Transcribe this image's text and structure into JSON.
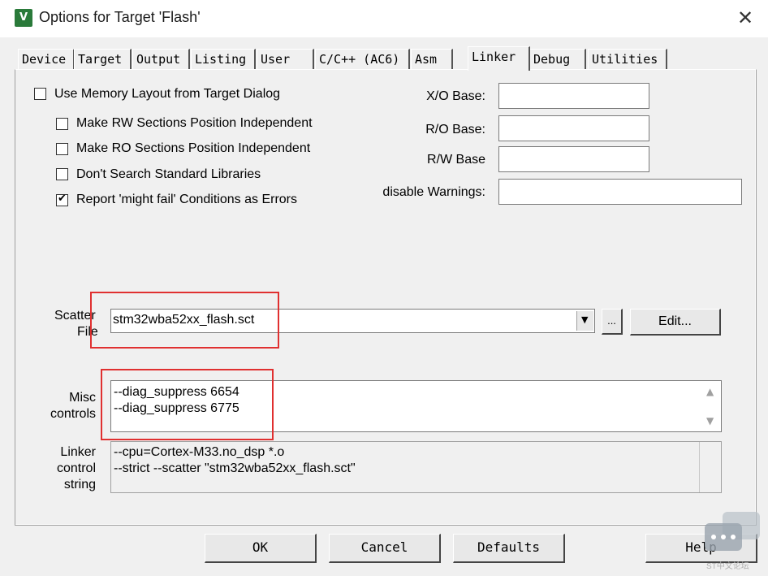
{
  "window": {
    "title": "Options for Target 'Flash'",
    "icon": "keil-uvision-icon",
    "close_glyph": "✕"
  },
  "tabs": [
    {
      "label": "Device"
    },
    {
      "label": "Target"
    },
    {
      "label": "Output"
    },
    {
      "label": "Listing"
    },
    {
      "label": "User"
    },
    {
      "label": "C/C++ (AC6)"
    },
    {
      "label": "Asm"
    },
    {
      "label": "Linker",
      "active": true
    },
    {
      "label": "Debug"
    },
    {
      "label": "Utilities"
    }
  ],
  "options": {
    "use_memory_layout": {
      "label": "Use Memory Layout from Target Dialog",
      "checked": false
    },
    "rw_position_independent": {
      "label": "Make RW Sections Position Independent",
      "checked": false
    },
    "ro_position_independent": {
      "label": "Make RO Sections Position Independent",
      "checked": false
    },
    "dont_search_std_libs": {
      "label": "Don't Search Standard Libraries",
      "checked": false
    },
    "report_might_fail": {
      "label": "Report 'might fail' Conditions as Errors",
      "checked": true
    }
  },
  "bases": {
    "xo_label": "X/O Base:",
    "xo_value": "",
    "ro_label": "R/O Base:",
    "ro_value": "",
    "rw_label": "R/W Base",
    "rw_value": "",
    "warnings_label": "disable Warnings:",
    "warnings_value": ""
  },
  "scatter": {
    "label_line1": "Scatter",
    "label_line2": "File",
    "value": "stm32wba52xx_flash.sct",
    "browse_label": "...",
    "edit_label": "Edit..."
  },
  "misc": {
    "label_line1": "Misc",
    "label_line2": "controls",
    "lines": "--diag_suppress 6654\n--diag_suppress 6775"
  },
  "linker_string": {
    "label_line1": "Linker",
    "label_line2": "control",
    "label_line3": "string",
    "lines": "--cpu=Cortex-M33.no_dsp *.o\n--strict --scatter \"stm32wba52xx_flash.sct\""
  },
  "buttons": {
    "ok": "OK",
    "cancel": "Cancel",
    "defaults": "Defaults",
    "help": "Help"
  },
  "watermark": {
    "text": "ST中文论坛"
  }
}
